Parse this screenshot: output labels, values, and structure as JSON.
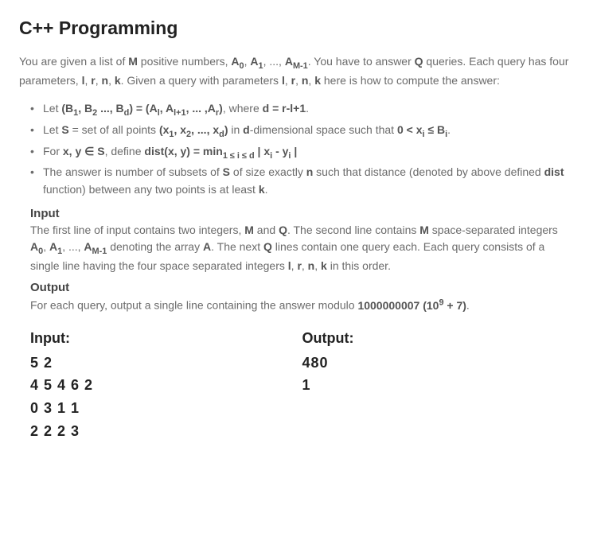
{
  "title": "C++ Programming",
  "intro_html": "You are given a list of <b>M</b> positive numbers, <b>A<sub>0</sub></b>, <b>A<sub>1</sub></b>, ..., <b>A<sub>M-1</sub></b>. You have to answer <b>Q</b> queries. Each query has four parameters, <b>l</b>, <b>r</b>, <b>n</b>, <b>k</b>. Given a query with parameters <b>l</b>, <b>r</b>, <b>n</b>, <b>k</b> here is how to compute the answer:",
  "bullets_html": [
    "Let <b>(B<sub>1</sub>, B<sub>2</sub> ..., B<sub>d</sub>) = (A<sub>l</sub>, A<sub>l+1</sub>, ... ,A<sub>r</sub>)</b>, where <b>d = r-l+1</b>.",
    "Let <b>S</b> = set of all points <b>(x<sub>1</sub>, x<sub>2</sub>, ..., x<sub>d</sub>)</b> in <b>d</b>-dimensional space such that <b>0 &lt; x<sub>i</sub> ≤ B<sub>i</sub></b>.",
    "For <b>x, y ∈ S</b>, define <b>dist(x, y) = min<sub>1 ≤ i ≤ d</sub> | x<sub>i</sub> - y<sub>i</sub> |</b>",
    "The answer is number of subsets of <b>S</b> of size exactly <b>n</b> such that distance (denoted by above defined <b>dist</b> function) between any two points is at least <b>k</b>."
  ],
  "input_head": "Input",
  "input_body_html": "The first line of input contains two integers, <b>M</b> and <b>Q</b>. The second line contains <b>M</b> space-separated integers <b>A<sub>0</sub></b>, <b>A<sub>1</sub></b>, ..., <b>A<sub>M-1</sub></b> denoting the array <b>A</b>. The next <b>Q</b> lines contain one query each. Each query consists of a single line having the four space separated integers <b>l</b>, <b>r</b>, <b>n</b>, <b>k</b> in this order.",
  "output_head": "Output",
  "output_body_html": "For each query, output a single line containing the answer modulo <b>1000000007 (10<sup>9</sup> + 7)</b>.",
  "sample": {
    "input_label": "Input:",
    "output_label": "Output:",
    "input_lines": [
      "5 2",
      "4 5 4 6 2",
      "0 3 1 1",
      "2 2 2 3"
    ],
    "output_lines": [
      "480",
      "1"
    ]
  }
}
